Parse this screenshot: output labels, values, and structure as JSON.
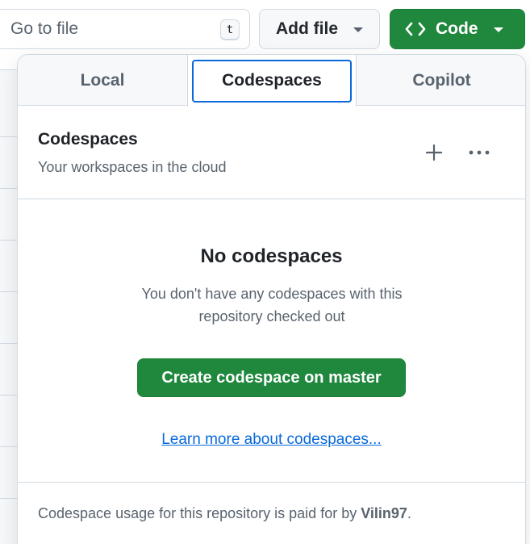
{
  "topbar": {
    "goto_placeholder": "Go to file",
    "goto_shortcut": "t",
    "add_file_label": "Add file",
    "code_label": "Code"
  },
  "panel": {
    "tabs": [
      {
        "label": "Local"
      },
      {
        "label": "Codespaces"
      },
      {
        "label": "Copilot"
      }
    ],
    "active_tab": "Codespaces",
    "header": {
      "title": "Codespaces",
      "subtitle": "Your workspaces in the cloud"
    },
    "empty": {
      "heading": "No codespaces",
      "description": "You don't have any codespaces with this repository checked out",
      "create_label": "Create codespace on master",
      "learn_more": "Learn more about codespaces..."
    },
    "footer": {
      "prefix": "Codespace usage for this repository is paid for by ",
      "user": "Vilin97",
      "suffix": "."
    }
  },
  "colors": {
    "primary_green": "#1f883d",
    "link_blue": "#0969da",
    "muted_text": "#59636e",
    "border": "#d1d9e0"
  }
}
